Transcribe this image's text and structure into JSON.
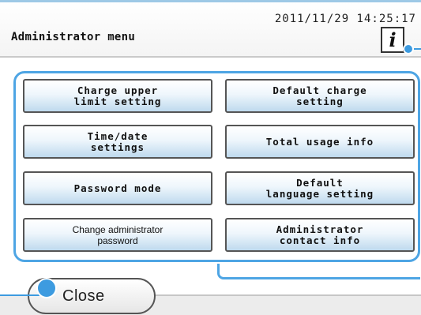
{
  "header": {
    "datetime": "2011/11/29 14:25:17",
    "title": "Administrator menu",
    "info_label": "i"
  },
  "menu": {
    "buttons": [
      {
        "label": "Charge upper\nlimit setting"
      },
      {
        "label": "Default charge\nsetting"
      },
      {
        "label": "Time/date\nsettings"
      },
      {
        "label": "Total usage info"
      },
      {
        "label": "Password mode"
      },
      {
        "label": "Default\nlanguage setting"
      },
      {
        "label": "Change administrator\npassword"
      },
      {
        "label": "Administrator\ncontact info"
      }
    ]
  },
  "footer": {
    "close_label": "Close"
  },
  "colors": {
    "accent": "#3d9be0",
    "button_gradient_end": "#bfdaee"
  },
  "icons": [
    "info-icon"
  ]
}
